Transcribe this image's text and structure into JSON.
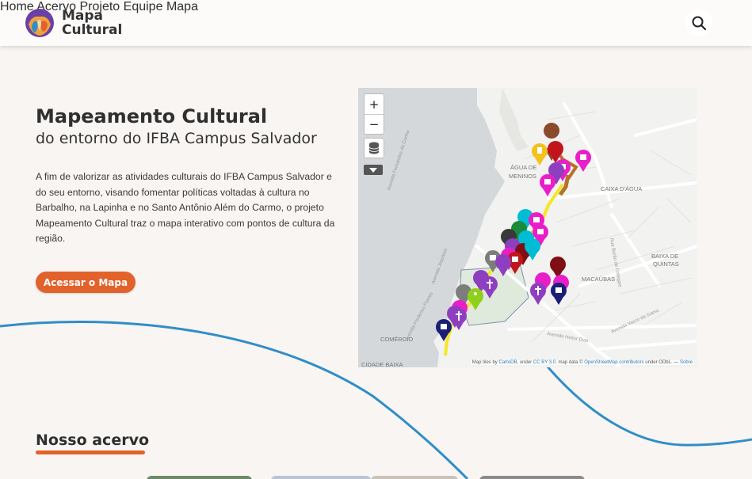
{
  "header": {
    "brand_line1": "Mapa",
    "brand_line2": "Cultural",
    "nav": [
      "Home",
      "Acervo",
      "Projeto",
      "Equipe",
      "Mapa"
    ],
    "search_icon": "search-icon"
  },
  "hero": {
    "title": "Mapeamento Cultural",
    "subtitle": "do entorno do IFBA Campus Salvador",
    "description": "A fim de valorizar as atividades culturais do IFBA Campus Salvador e do seu entorno, visando fomentar políticas voltadas à cultura no Barbalho, na Lapinha e no Santo Antônio Além do Carmo, o projeto Mapeamento Cultural traz o mapa interativo com pontos de cultura da região.",
    "button_label": "Acessar o Mapa"
  },
  "map": {
    "zoom_in": "+",
    "zoom_out": "−",
    "place_labels": [
      "ÁGUA DE",
      "MENINOS",
      "CAIXA D'ÁGUA",
      "BAIXA DE",
      "QUINTAS",
      "MACAÚBAS",
      "COMÉRCIO",
      "CIDADE BAIXA",
      "Avenida Frederico Pontes",
      "Avenida Vasco da Gama",
      "Avenida Jequitaia",
      "Avenida Heitor Dias",
      "Rua Barão de Cotegipe",
      "Avenida Fernandes da Cunha"
    ],
    "attribution": {
      "prefix": "Map tiles by",
      "cartodb": "CartoDB",
      "under1": ", under",
      "license": "CC BY 3.0",
      "mid": ". map data ©",
      "osm": "OpenStreetMap contributors",
      "under2": "under ODbL. —",
      "source": "Sobre"
    },
    "marker_colors": [
      "#e91ec9",
      "#8e3fbf",
      "#c0161b",
      "#00bcd4",
      "#1c8a3c",
      "#1b1e78",
      "#7d7d7d",
      "#f5c11d",
      "#8fd11a",
      "#7f0f14",
      "#8b4a2a",
      "#3a3a3a"
    ]
  },
  "acervo": {
    "title": "Nosso acervo"
  },
  "colors": {
    "accent": "#e2622b",
    "wave": "#2f8ec7",
    "background": "#f8f5f2"
  }
}
